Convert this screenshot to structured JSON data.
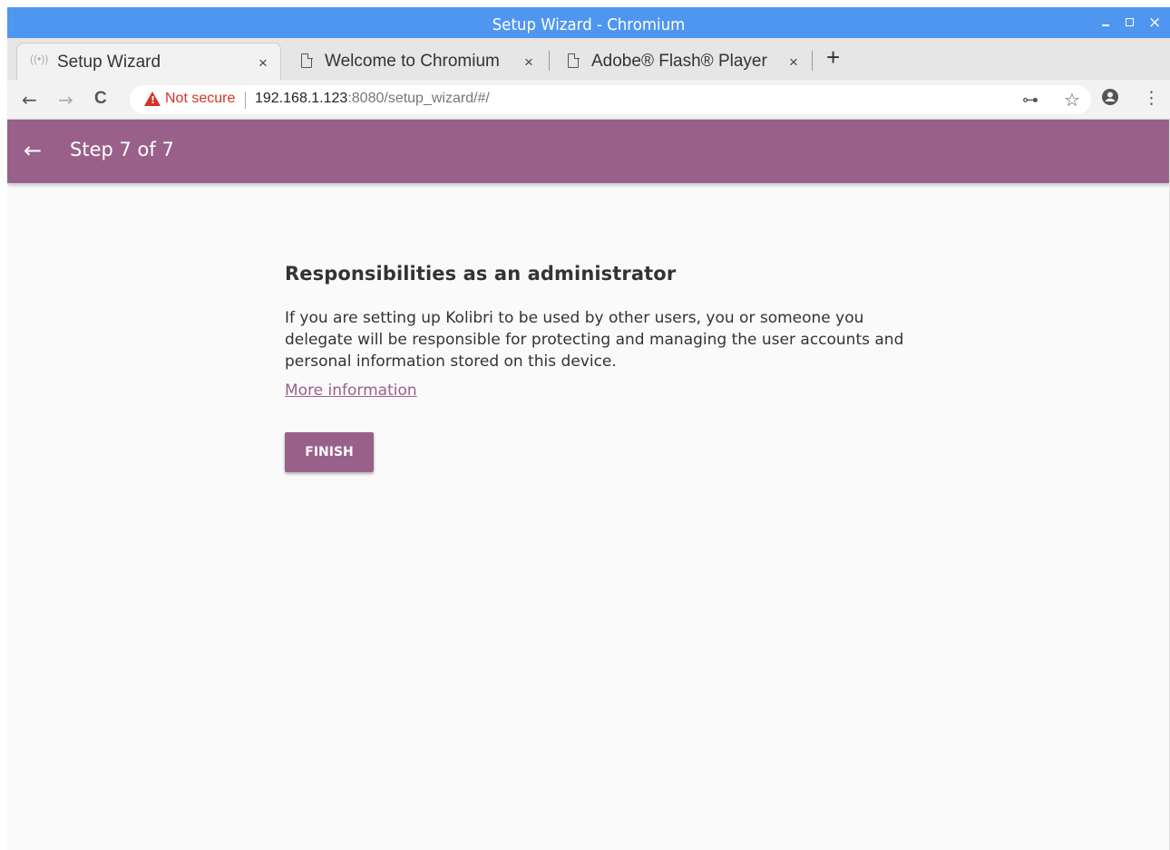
{
  "window": {
    "title": "Setup Wizard - Chromium",
    "controls": {
      "minimize": "minimize",
      "maximize": "maximize",
      "close": "×"
    }
  },
  "tabs": [
    {
      "label": "Setup Wizard",
      "active": true,
      "icon": "loading-icon",
      "close": "×"
    },
    {
      "label": "Welcome to Chromium",
      "active": false,
      "icon": "page-icon",
      "close": "×"
    },
    {
      "label": "Adobe® Flash® Player",
      "active": false,
      "icon": "page-icon",
      "close": "×"
    }
  ],
  "new_tab": "+",
  "toolbar": {
    "back": "←",
    "forward": "→",
    "reload": "C",
    "security_label": "Not secure",
    "url_host": "192.168.1.123",
    "url_rest": ":8080/setup_wizard/#/",
    "key": "⊶",
    "star": "☆",
    "menu": "⋮"
  },
  "appbar": {
    "back": "←",
    "step": "Step 7 of 7"
  },
  "main": {
    "heading": "Responsibilities as an administrator",
    "body": "If you are setting up Kolibri to be used by other users, you or someone you delegate will be responsible for protecting and managing the user accounts and personal information stored on this device.",
    "link": "More information",
    "finish_label": "FINISH"
  },
  "colors": {
    "titlebar": "#4f96f0",
    "accent": "#996189",
    "warning": "#d93025"
  }
}
